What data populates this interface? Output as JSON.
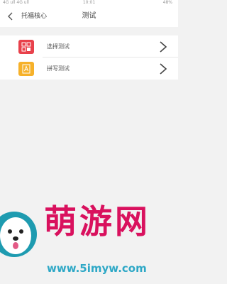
{
  "status_bar": {
    "carrier": "4G ull 4G ull",
    "time": "10:01",
    "battery": "48%"
  },
  "nav": {
    "back_label": "托福核心",
    "title": "测试"
  },
  "menu": {
    "items": [
      {
        "label": "选择测试",
        "icon": "select-test-icon",
        "icon_color": "#e8414b"
      },
      {
        "label": "拼写测试",
        "icon": "spell-test-icon",
        "icon_color": "#f6b12a"
      }
    ]
  },
  "watermark": {
    "logo_text": "萌游网",
    "url": "www.5imyw.com"
  }
}
